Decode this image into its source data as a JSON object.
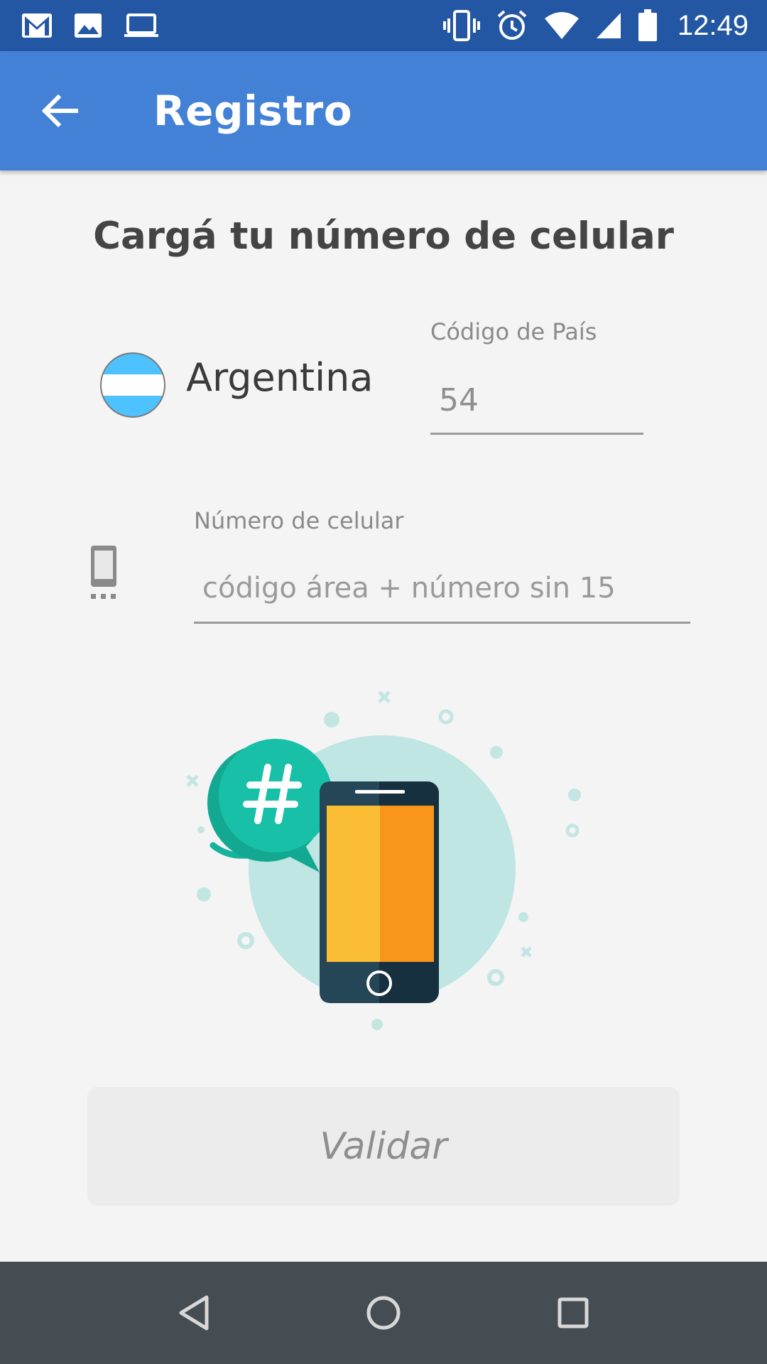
{
  "status_bar": {
    "time": "12:49",
    "left_icons": [
      "gmail-icon",
      "image-icon",
      "laptop-icon"
    ],
    "right_icons": [
      "vibrate-icon",
      "alarm-icon",
      "wifi-icon",
      "signal-icon",
      "battery-icon"
    ]
  },
  "app_bar": {
    "title": "Registro",
    "back_icon": "arrow-left-icon",
    "color": "#4381d7"
  },
  "main": {
    "heading": "Cargá tu número de celular",
    "country": {
      "name": "Argentina",
      "flag_icon": "argentina-flag-icon"
    },
    "country_code": {
      "label": "Código de País",
      "value": "54"
    },
    "phone_number": {
      "label": "Número de celular",
      "placeholder": "código área + número sin 15",
      "value": ""
    },
    "illustration_icon": "phone-hashtag-illustration",
    "validate_label": "Validar"
  },
  "nav_bar": {
    "icons": [
      "back-triangle-icon",
      "home-circle-icon",
      "recents-square-icon"
    ]
  },
  "colors": {
    "status_bar": "#2457a3",
    "app_bar": "#4381d7",
    "background": "#f4f4f4",
    "accent_teal": "#1fb9a3",
    "phone_orange": "#f8961c",
    "phone_yellow": "#fbbd33"
  }
}
